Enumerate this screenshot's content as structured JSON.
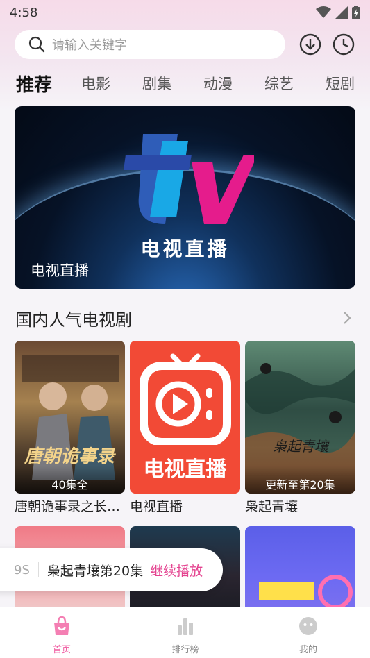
{
  "status_bar": {
    "time": "4:58"
  },
  "search": {
    "placeholder": "请输入关键字"
  },
  "tabs": [
    {
      "label": "推荐",
      "active": true
    },
    {
      "label": "电影"
    },
    {
      "label": "剧集"
    },
    {
      "label": "动漫"
    },
    {
      "label": "综艺"
    },
    {
      "label": "短剧"
    }
  ],
  "banner": {
    "logo_text": "电视直播",
    "caption": "电视直播"
  },
  "section": {
    "title": "国内人气电视剧"
  },
  "cards": [
    {
      "title": "唐朝诡事录之长…",
      "badge": "40集全",
      "poster_text": "唐朝诡事录"
    },
    {
      "title": "电视直播",
      "badge": "",
      "poster_text": "电视直播"
    },
    {
      "title": "枭起青壤",
      "badge": "更新至第20集",
      "poster_text": "枭起青壤"
    }
  ],
  "continue_watching": {
    "tag": "9S",
    "text": "枭起青壤第20集",
    "action": "继续播放"
  },
  "bottom_nav": [
    {
      "label": "首页",
      "active": true
    },
    {
      "label": "排行榜"
    },
    {
      "label": "我的"
    }
  ],
  "colors": {
    "accent": "#f05aa0",
    "continue_action": "#e4428f",
    "tv_red": "#f24a36"
  }
}
